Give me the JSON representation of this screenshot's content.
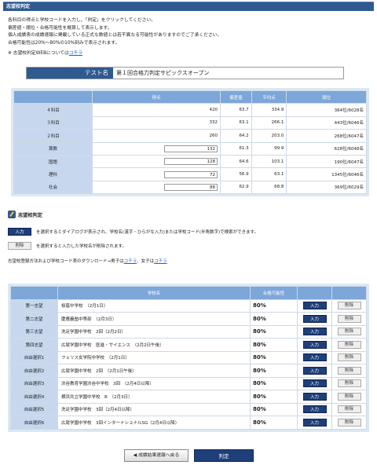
{
  "header": {
    "title": "志望校判定"
  },
  "intro": {
    "lines": [
      "各科目の得点と学校コードを入力し、「判定」をクリックしてください。",
      "偏差値・順位・合格可能性を概算して表示します。",
      "個人成績表の成績速報に掲載している正式な数値とは若干異なる可能性がありますのでご了承ください。",
      "合格可能性は20%〜80%の10%刻みで表示されます。"
    ],
    "note_prefix": "※ 志望校判定WEBについては",
    "note_link": "コチラ"
  },
  "test": {
    "label": "テスト名",
    "value": "第１回合格力判定サピックスオープン"
  },
  "scores": {
    "headers": [
      "",
      "得点",
      "偏差値",
      "平均点",
      "順位"
    ],
    "rows": [
      {
        "subject": "４科目",
        "score": "420",
        "dev": "63.7",
        "avg": "334.9",
        "rank": "364位/6028名",
        "input": false
      },
      {
        "subject": "３科目",
        "score": "332",
        "dev": "63.1",
        "avg": "266.1",
        "rank": "443位/6046名",
        "input": false
      },
      {
        "subject": "２科目",
        "score": "260",
        "dev": "64.2",
        "avg": "203.0",
        "rank": "268位/6047名",
        "input": false
      },
      {
        "subject": "算数",
        "score": "132",
        "dev": "61.3",
        "avg": "99.9",
        "rank": "628位/6048名",
        "input": true
      },
      {
        "subject": "国語",
        "score": "128",
        "dev": "64.6",
        "avg": "103.1",
        "rank": "190位/6047名",
        "input": true
      },
      {
        "subject": "理科",
        "score": "72",
        "dev": "56.9",
        "avg": "63.1",
        "rank": "1345位/6046名",
        "input": true
      },
      {
        "subject": "社会",
        "score": "88",
        "dev": "62.9",
        "avg": "68.8",
        "rank": "369位/6029名",
        "input": true
      }
    ]
  },
  "judge": {
    "title": "志望校判定",
    "input_label": "入力",
    "input_desc": "を選択するとダイアログが表示され、学校名(漢字・ひらがな入力)または学校コード(半角数字)で検索ができます。",
    "delete_label": "削除",
    "delete_desc": "を選択すると入力した学校名が削除されます。",
    "download_prefix": "志望校登録方法および学校コード表のダウンロード→男子は",
    "download_link1": "コチラ",
    "download_mid": "、女子は",
    "download_link2": "コチラ"
  },
  "schools": {
    "headers": [
      "",
      "学校名",
      "合格可能性",
      "",
      ""
    ],
    "rows": [
      {
        "label": "第一志望",
        "name": "桜蔭中学校　（2月1日）",
        "pct": "80%"
      },
      {
        "label": "第二志望",
        "name": "慶應義塾中等部　（2月3日）",
        "pct": "80%"
      },
      {
        "label": "第三志望",
        "name": "洗足学園中学校　2回（2月2日）",
        "pct": "80%"
      },
      {
        "label": "第四志望",
        "name": "広尾学園中学校　医進・サイエンス　（2月2日午後）",
        "pct": "80%"
      },
      {
        "label": "自由選択1",
        "name": "フェリス女学院中学校　（2月1日）",
        "pct": "80%"
      },
      {
        "label": "自由選択2",
        "name": "広尾学園中学校　2回　（2月1日午後）",
        "pct": "80%"
      },
      {
        "label": "自由選択3",
        "name": "渋谷教育学園渋谷中学校　3回　（2月4日以降）",
        "pct": "80%"
      },
      {
        "label": "自由選択4",
        "name": "横浜共立学園中学校　B　（2月3日）",
        "pct": "80%"
      },
      {
        "label": "自由選択5",
        "name": "洗足学園中学校　3回（2月4日以降）",
        "pct": "80%"
      },
      {
        "label": "自由選択6",
        "name": "広尾学園中学校　3回インターナショナルSG（2月4日以降）",
        "pct": "80%"
      }
    ],
    "input_label": "入力",
    "delete_label": "削除"
  },
  "footer": {
    "back_label": "成績結果速報へ戻る",
    "judge_label": "判定"
  }
}
